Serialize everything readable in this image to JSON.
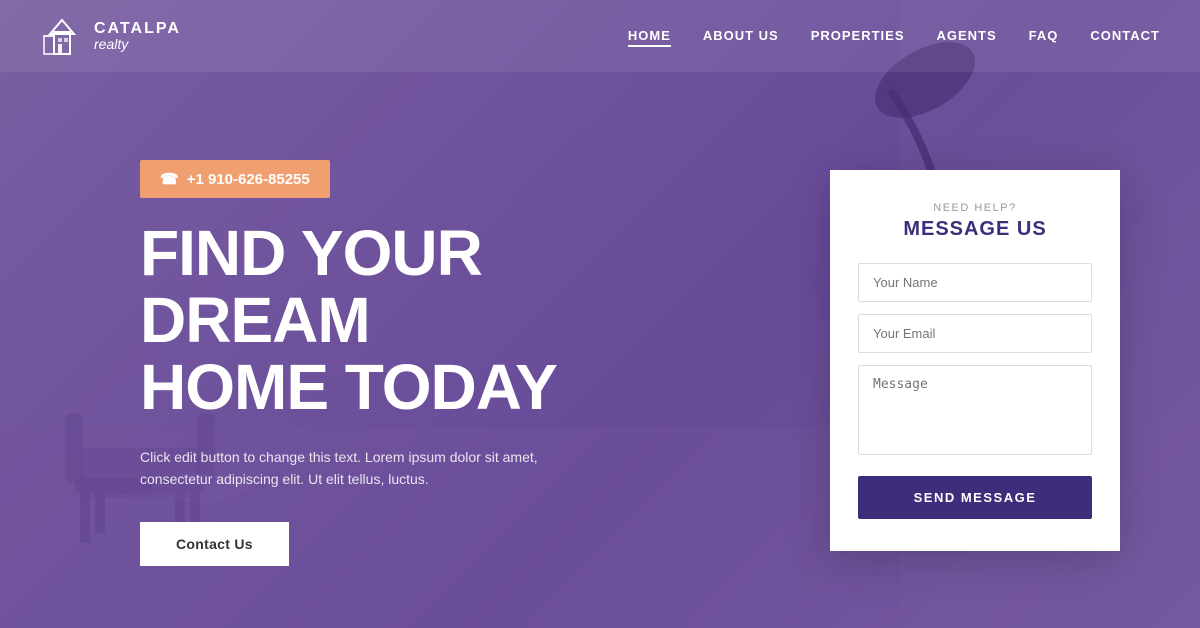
{
  "brand": {
    "name_upper": "CATALPA",
    "name_lower": "realty"
  },
  "nav": {
    "items": [
      {
        "label": "HOME",
        "active": true
      },
      {
        "label": "ABOUT US",
        "active": false
      },
      {
        "label": "PROPERTIES",
        "active": false
      },
      {
        "label": "AGENTS",
        "active": false
      },
      {
        "label": "FAQ",
        "active": false
      },
      {
        "label": "CONTACT",
        "active": false
      }
    ]
  },
  "hero": {
    "phone": "+1 910-626-85255",
    "phone_icon": "☎",
    "title_line1": "FIND YOUR DREAM",
    "title_line2": "HOME TODAY",
    "description": "Click edit button to change this text. Lorem ipsum dolor sit amet, consectetur adipiscing elit. Ut elit tellus, luctus.",
    "cta_label": "Contact Us"
  },
  "contact_form": {
    "subtitle": "NEED HELP?",
    "title": "MESSAGE US",
    "name_placeholder": "Your Name",
    "email_placeholder": "Your Email",
    "message_placeholder": "Message",
    "submit_label": "SEND MESSAGE"
  },
  "colors": {
    "accent_orange": "#f0a070",
    "accent_purple": "#3d2d7a",
    "overlay": "rgba(90, 60, 140, 0.72)"
  }
}
